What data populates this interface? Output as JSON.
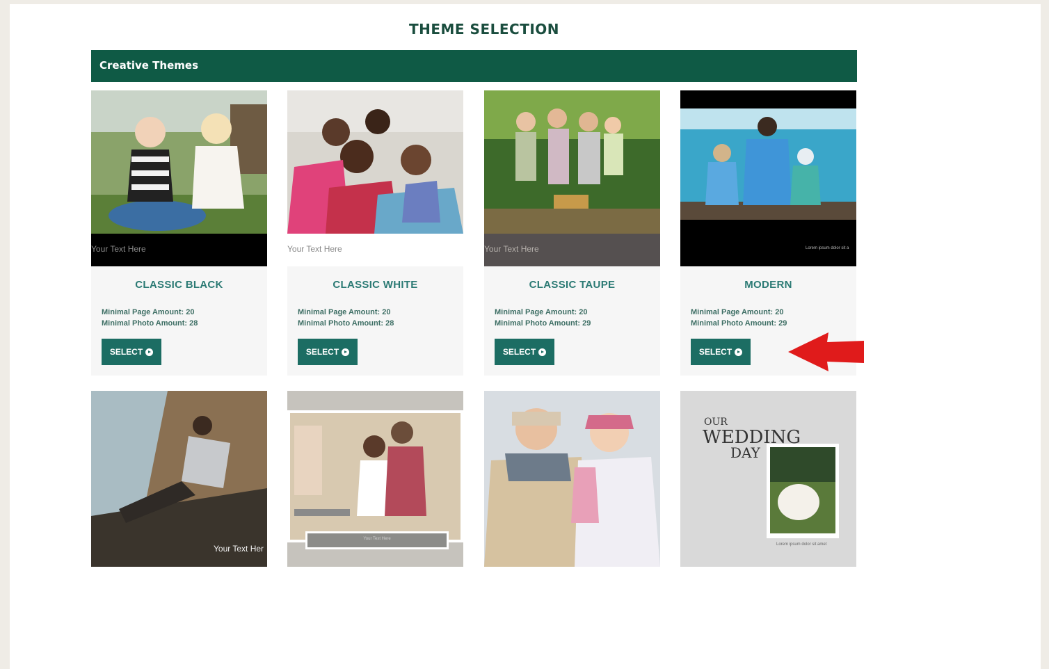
{
  "page": {
    "title": "THEME SELECTION"
  },
  "section": {
    "label": "Creative Themes"
  },
  "themes": [
    {
      "name": "CLASSIC BLACK",
      "page_amount": "Minimal Page Amount: 20",
      "photo_amount": "Minimal Photo Amount: 28",
      "caption": "Your Text Here",
      "select_label": "SELECT"
    },
    {
      "name": "CLASSIC WHITE",
      "page_amount": "Minimal Page Amount: 20",
      "photo_amount": "Minimal Photo Amount: 28",
      "caption": "Your Text Here",
      "select_label": "SELECT"
    },
    {
      "name": "CLASSIC TAUPE",
      "page_amount": "Minimal Page Amount: 20",
      "photo_amount": "Minimal Photo Amount: 29",
      "caption": "Your Text Here",
      "select_label": "SELECT"
    },
    {
      "name": "MODERN",
      "page_amount": "Minimal Page Amount: 20",
      "photo_amount": "Minimal Photo Amount: 29",
      "caption": "Lorem ipsum dolor sit a",
      "select_label": "SELECT"
    }
  ],
  "second_row": [
    {
      "caption": "Your Text Her"
    },
    {
      "caption": "Your Text Here"
    },
    {
      "caption": ""
    },
    {
      "title_line1": "OUR",
      "title_line2": "WEDDING",
      "title_line3": "DAY",
      "caption": "Lorem ipsum dolor sit amet"
    }
  ],
  "colors": {
    "brand_green": "#0f5a45",
    "button_teal": "#1c6d63",
    "pointer_red": "#e01b1b"
  }
}
